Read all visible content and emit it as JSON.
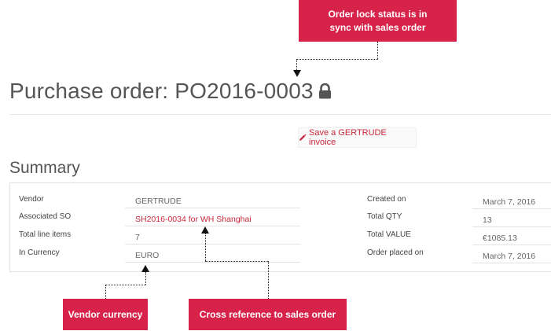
{
  "callouts": {
    "lock_status": "Order  lock status is in sync with sales order",
    "vendor_currency": "Vendor currency",
    "cross_reference": "Cross reference to sales order"
  },
  "header": {
    "title": "Purchase order: PO2016-0003",
    "lock_icon": "lock-icon"
  },
  "actions": {
    "save_invoice_label": "Save a GERTRUDE invoice",
    "save_invoice_icon": "pencil-icon"
  },
  "summary": {
    "heading": "Summary",
    "left": [
      {
        "label": "Vendor",
        "value": "GERTRUDE"
      },
      {
        "label": "Associated SO",
        "value": "SH2016-0034 for WH Shanghai"
      },
      {
        "label": "Total line items",
        "value": "7"
      },
      {
        "label": "In Currency",
        "value": "EURO"
      }
    ],
    "right": [
      {
        "label": "Created on",
        "value": "March 7, 2016"
      },
      {
        "label": "Total QTY",
        "value": "13"
      },
      {
        "label": "Total VALUE",
        "value": "€1085.13"
      },
      {
        "label": "Order placed on",
        "value": "March 7, 2016"
      }
    ]
  },
  "colors": {
    "accent": "#d7234a",
    "link": "#c8283a"
  }
}
